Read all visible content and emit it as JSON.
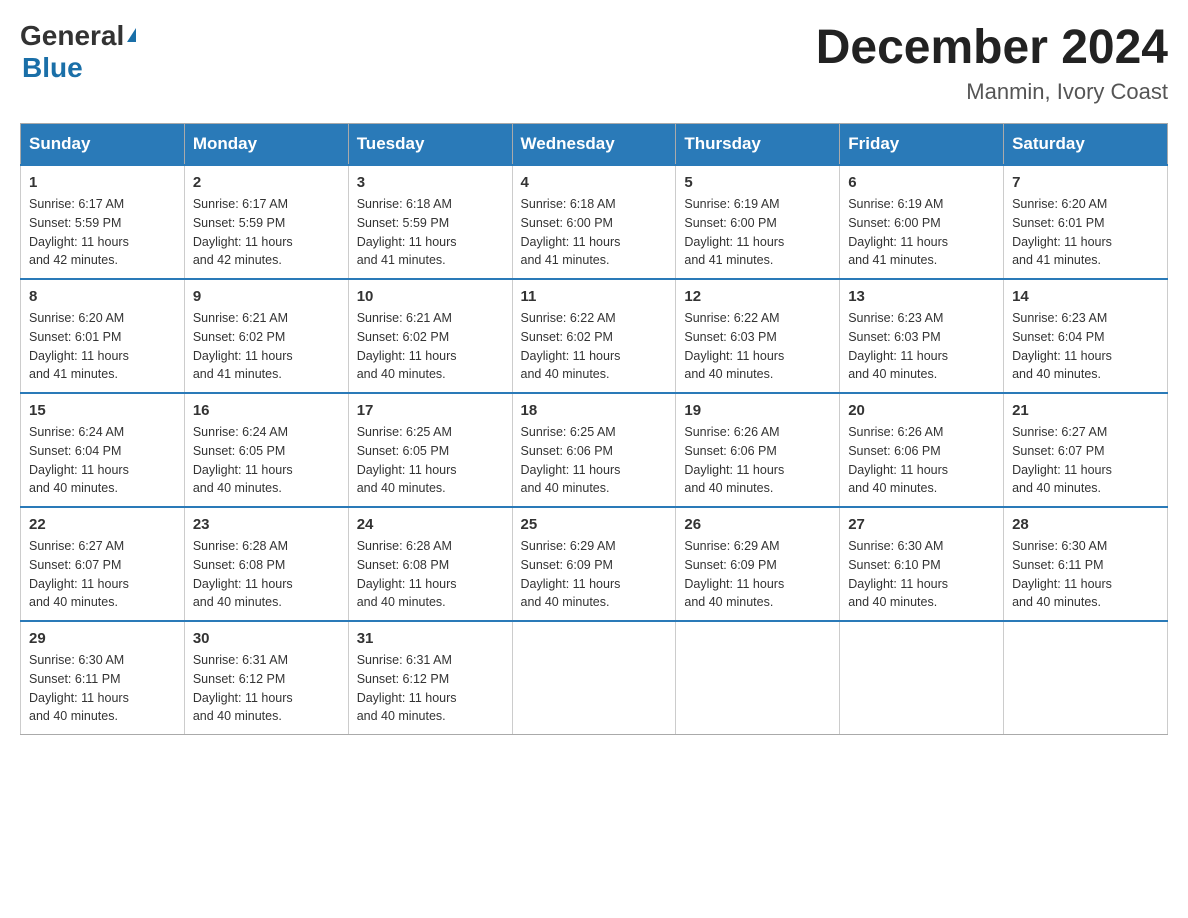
{
  "header": {
    "logo_general": "General",
    "logo_blue": "Blue",
    "main_title": "December 2024",
    "subtitle": "Manmin, Ivory Coast"
  },
  "days_of_week": [
    "Sunday",
    "Monday",
    "Tuesday",
    "Wednesday",
    "Thursday",
    "Friday",
    "Saturday"
  ],
  "weeks": [
    [
      {
        "day": "1",
        "sunrise": "6:17 AM",
        "sunset": "5:59 PM",
        "daylight": "11 hours and 42 minutes."
      },
      {
        "day": "2",
        "sunrise": "6:17 AM",
        "sunset": "5:59 PM",
        "daylight": "11 hours and 42 minutes."
      },
      {
        "day": "3",
        "sunrise": "6:18 AM",
        "sunset": "5:59 PM",
        "daylight": "11 hours and 41 minutes."
      },
      {
        "day": "4",
        "sunrise": "6:18 AM",
        "sunset": "6:00 PM",
        "daylight": "11 hours and 41 minutes."
      },
      {
        "day": "5",
        "sunrise": "6:19 AM",
        "sunset": "6:00 PM",
        "daylight": "11 hours and 41 minutes."
      },
      {
        "day": "6",
        "sunrise": "6:19 AM",
        "sunset": "6:00 PM",
        "daylight": "11 hours and 41 minutes."
      },
      {
        "day": "7",
        "sunrise": "6:20 AM",
        "sunset": "6:01 PM",
        "daylight": "11 hours and 41 minutes."
      }
    ],
    [
      {
        "day": "8",
        "sunrise": "6:20 AM",
        "sunset": "6:01 PM",
        "daylight": "11 hours and 41 minutes."
      },
      {
        "day": "9",
        "sunrise": "6:21 AM",
        "sunset": "6:02 PM",
        "daylight": "11 hours and 41 minutes."
      },
      {
        "day": "10",
        "sunrise": "6:21 AM",
        "sunset": "6:02 PM",
        "daylight": "11 hours and 40 minutes."
      },
      {
        "day": "11",
        "sunrise": "6:22 AM",
        "sunset": "6:02 PM",
        "daylight": "11 hours and 40 minutes."
      },
      {
        "day": "12",
        "sunrise": "6:22 AM",
        "sunset": "6:03 PM",
        "daylight": "11 hours and 40 minutes."
      },
      {
        "day": "13",
        "sunrise": "6:23 AM",
        "sunset": "6:03 PM",
        "daylight": "11 hours and 40 minutes."
      },
      {
        "day": "14",
        "sunrise": "6:23 AM",
        "sunset": "6:04 PM",
        "daylight": "11 hours and 40 minutes."
      }
    ],
    [
      {
        "day": "15",
        "sunrise": "6:24 AM",
        "sunset": "6:04 PM",
        "daylight": "11 hours and 40 minutes."
      },
      {
        "day": "16",
        "sunrise": "6:24 AM",
        "sunset": "6:05 PM",
        "daylight": "11 hours and 40 minutes."
      },
      {
        "day": "17",
        "sunrise": "6:25 AM",
        "sunset": "6:05 PM",
        "daylight": "11 hours and 40 minutes."
      },
      {
        "day": "18",
        "sunrise": "6:25 AM",
        "sunset": "6:06 PM",
        "daylight": "11 hours and 40 minutes."
      },
      {
        "day": "19",
        "sunrise": "6:26 AM",
        "sunset": "6:06 PM",
        "daylight": "11 hours and 40 minutes."
      },
      {
        "day": "20",
        "sunrise": "6:26 AM",
        "sunset": "6:06 PM",
        "daylight": "11 hours and 40 minutes."
      },
      {
        "day": "21",
        "sunrise": "6:27 AM",
        "sunset": "6:07 PM",
        "daylight": "11 hours and 40 minutes."
      }
    ],
    [
      {
        "day": "22",
        "sunrise": "6:27 AM",
        "sunset": "6:07 PM",
        "daylight": "11 hours and 40 minutes."
      },
      {
        "day": "23",
        "sunrise": "6:28 AM",
        "sunset": "6:08 PM",
        "daylight": "11 hours and 40 minutes."
      },
      {
        "day": "24",
        "sunrise": "6:28 AM",
        "sunset": "6:08 PM",
        "daylight": "11 hours and 40 minutes."
      },
      {
        "day": "25",
        "sunrise": "6:29 AM",
        "sunset": "6:09 PM",
        "daylight": "11 hours and 40 minutes."
      },
      {
        "day": "26",
        "sunrise": "6:29 AM",
        "sunset": "6:09 PM",
        "daylight": "11 hours and 40 minutes."
      },
      {
        "day": "27",
        "sunrise": "6:30 AM",
        "sunset": "6:10 PM",
        "daylight": "11 hours and 40 minutes."
      },
      {
        "day": "28",
        "sunrise": "6:30 AM",
        "sunset": "6:11 PM",
        "daylight": "11 hours and 40 minutes."
      }
    ],
    [
      {
        "day": "29",
        "sunrise": "6:30 AM",
        "sunset": "6:11 PM",
        "daylight": "11 hours and 40 minutes."
      },
      {
        "day": "30",
        "sunrise": "6:31 AM",
        "sunset": "6:12 PM",
        "daylight": "11 hours and 40 minutes."
      },
      {
        "day": "31",
        "sunrise": "6:31 AM",
        "sunset": "6:12 PM",
        "daylight": "11 hours and 40 minutes."
      },
      null,
      null,
      null,
      null
    ]
  ],
  "labels": {
    "sunrise": "Sunrise:",
    "sunset": "Sunset:",
    "daylight": "Daylight:"
  }
}
